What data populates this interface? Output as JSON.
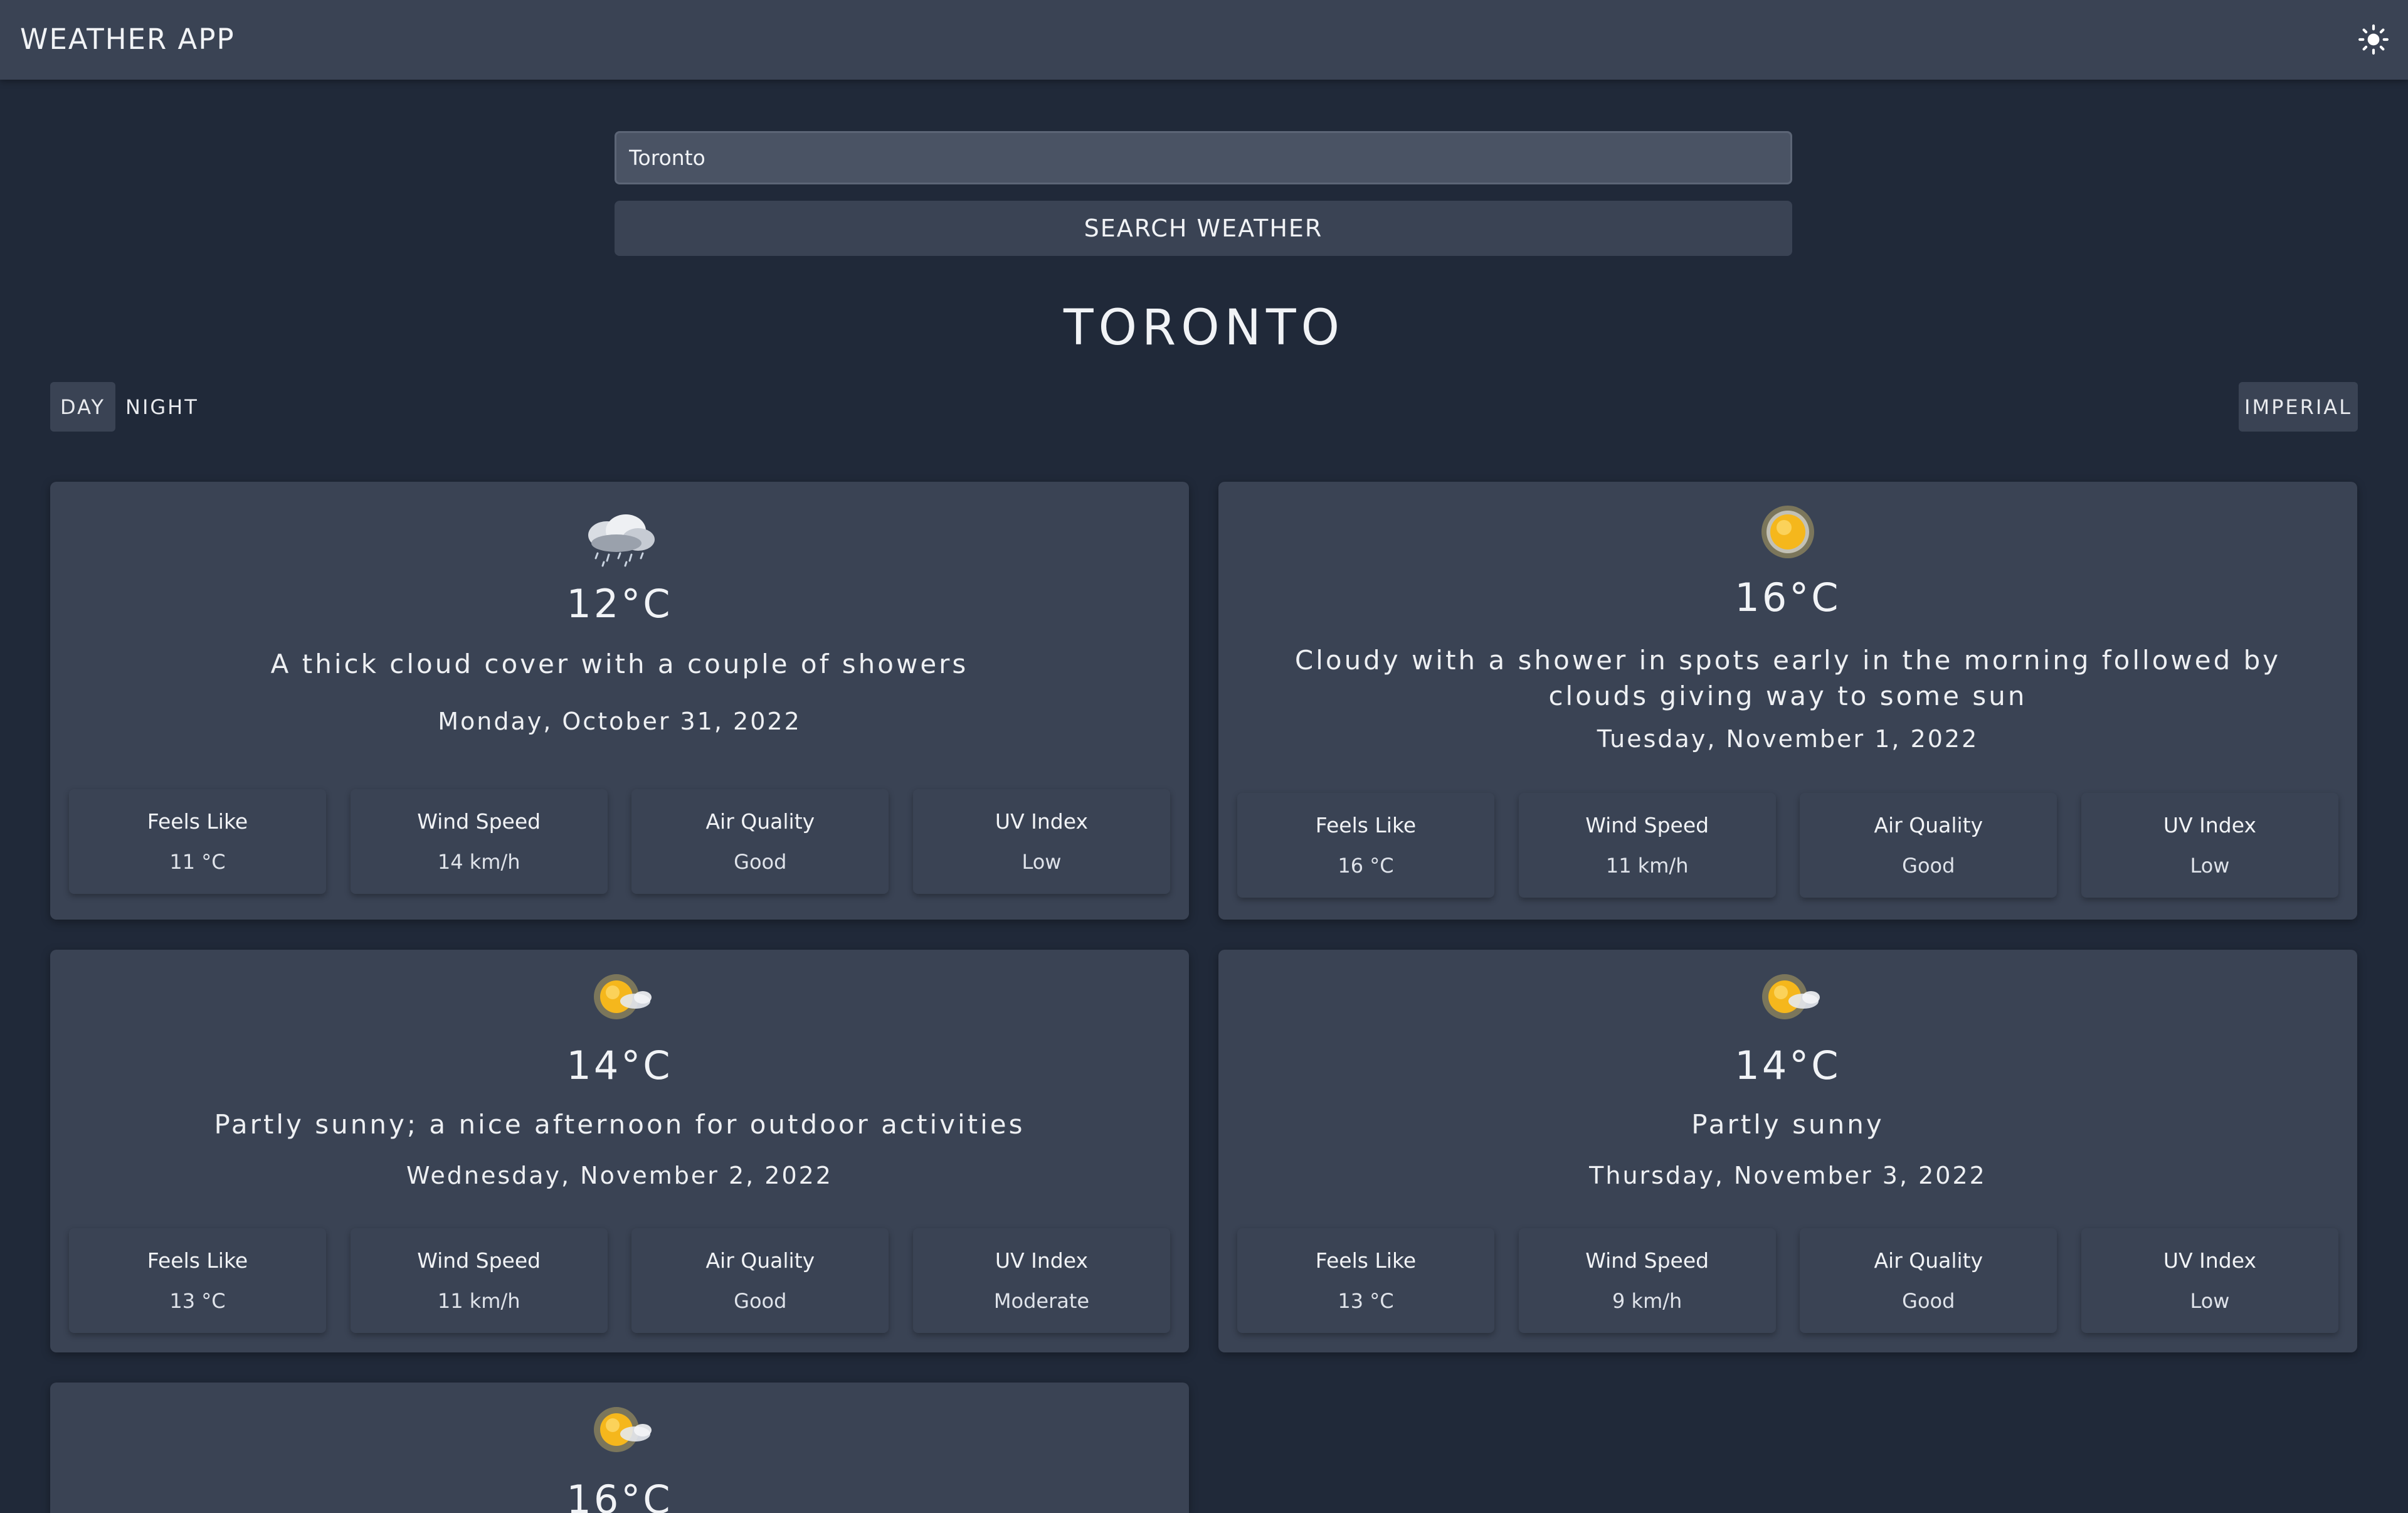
{
  "header": {
    "title": "WEATHER APP",
    "theme_icon": "sun-icon"
  },
  "search": {
    "value": "Toronto",
    "placeholder": "",
    "button_label": "SEARCH WEATHER"
  },
  "location": {
    "city": "TORONTO"
  },
  "toggles": {
    "day": "DAY",
    "night": "NIGHT",
    "units": "IMPERIAL"
  },
  "forecast": [
    {
      "icon": "rain-cloud-icon",
      "temp": "12°C",
      "description": "A thick cloud cover with a couple of showers",
      "date": "Monday, October 31, 2022",
      "stats": [
        {
          "label": "Feels Like",
          "value": "11 °C"
        },
        {
          "label": "Wind Speed",
          "value": "14 km/h"
        },
        {
          "label": "Air Quality",
          "value": "Good"
        },
        {
          "label": "UV Index",
          "value": "Low"
        }
      ]
    },
    {
      "icon": "sun-icon",
      "temp": "16°C",
      "description": "Cloudy with a shower in spots early in the morning followed by clouds giving way to some sun",
      "date": "Tuesday, November 1, 2022",
      "stats": [
        {
          "label": "Feels Like",
          "value": "16 °C"
        },
        {
          "label": "Wind Speed",
          "value": "11 km/h"
        },
        {
          "label": "Air Quality",
          "value": "Good"
        },
        {
          "label": "UV Index",
          "value": "Low"
        }
      ]
    },
    {
      "icon": "partly-sunny-icon",
      "temp": "14°C",
      "description": "Partly sunny; a nice afternoon for outdoor activities",
      "date": "Wednesday, November 2, 2022",
      "stats": [
        {
          "label": "Feels Like",
          "value": "13 °C"
        },
        {
          "label": "Wind Speed",
          "value": "11 km/h"
        },
        {
          "label": "Air Quality",
          "value": "Good"
        },
        {
          "label": "UV Index",
          "value": "Moderate"
        }
      ]
    },
    {
      "icon": "partly-sunny-icon",
      "temp": "14°C",
      "description": "Partly sunny",
      "date": "Thursday, November 3, 2022",
      "stats": [
        {
          "label": "Feels Like",
          "value": "13 °C"
        },
        {
          "label": "Wind Speed",
          "value": "9 km/h"
        },
        {
          "label": "Air Quality",
          "value": "Good"
        },
        {
          "label": "UV Index",
          "value": "Low"
        }
      ]
    },
    {
      "icon": "partly-sunny-icon",
      "temp": "16°C"
    }
  ]
}
